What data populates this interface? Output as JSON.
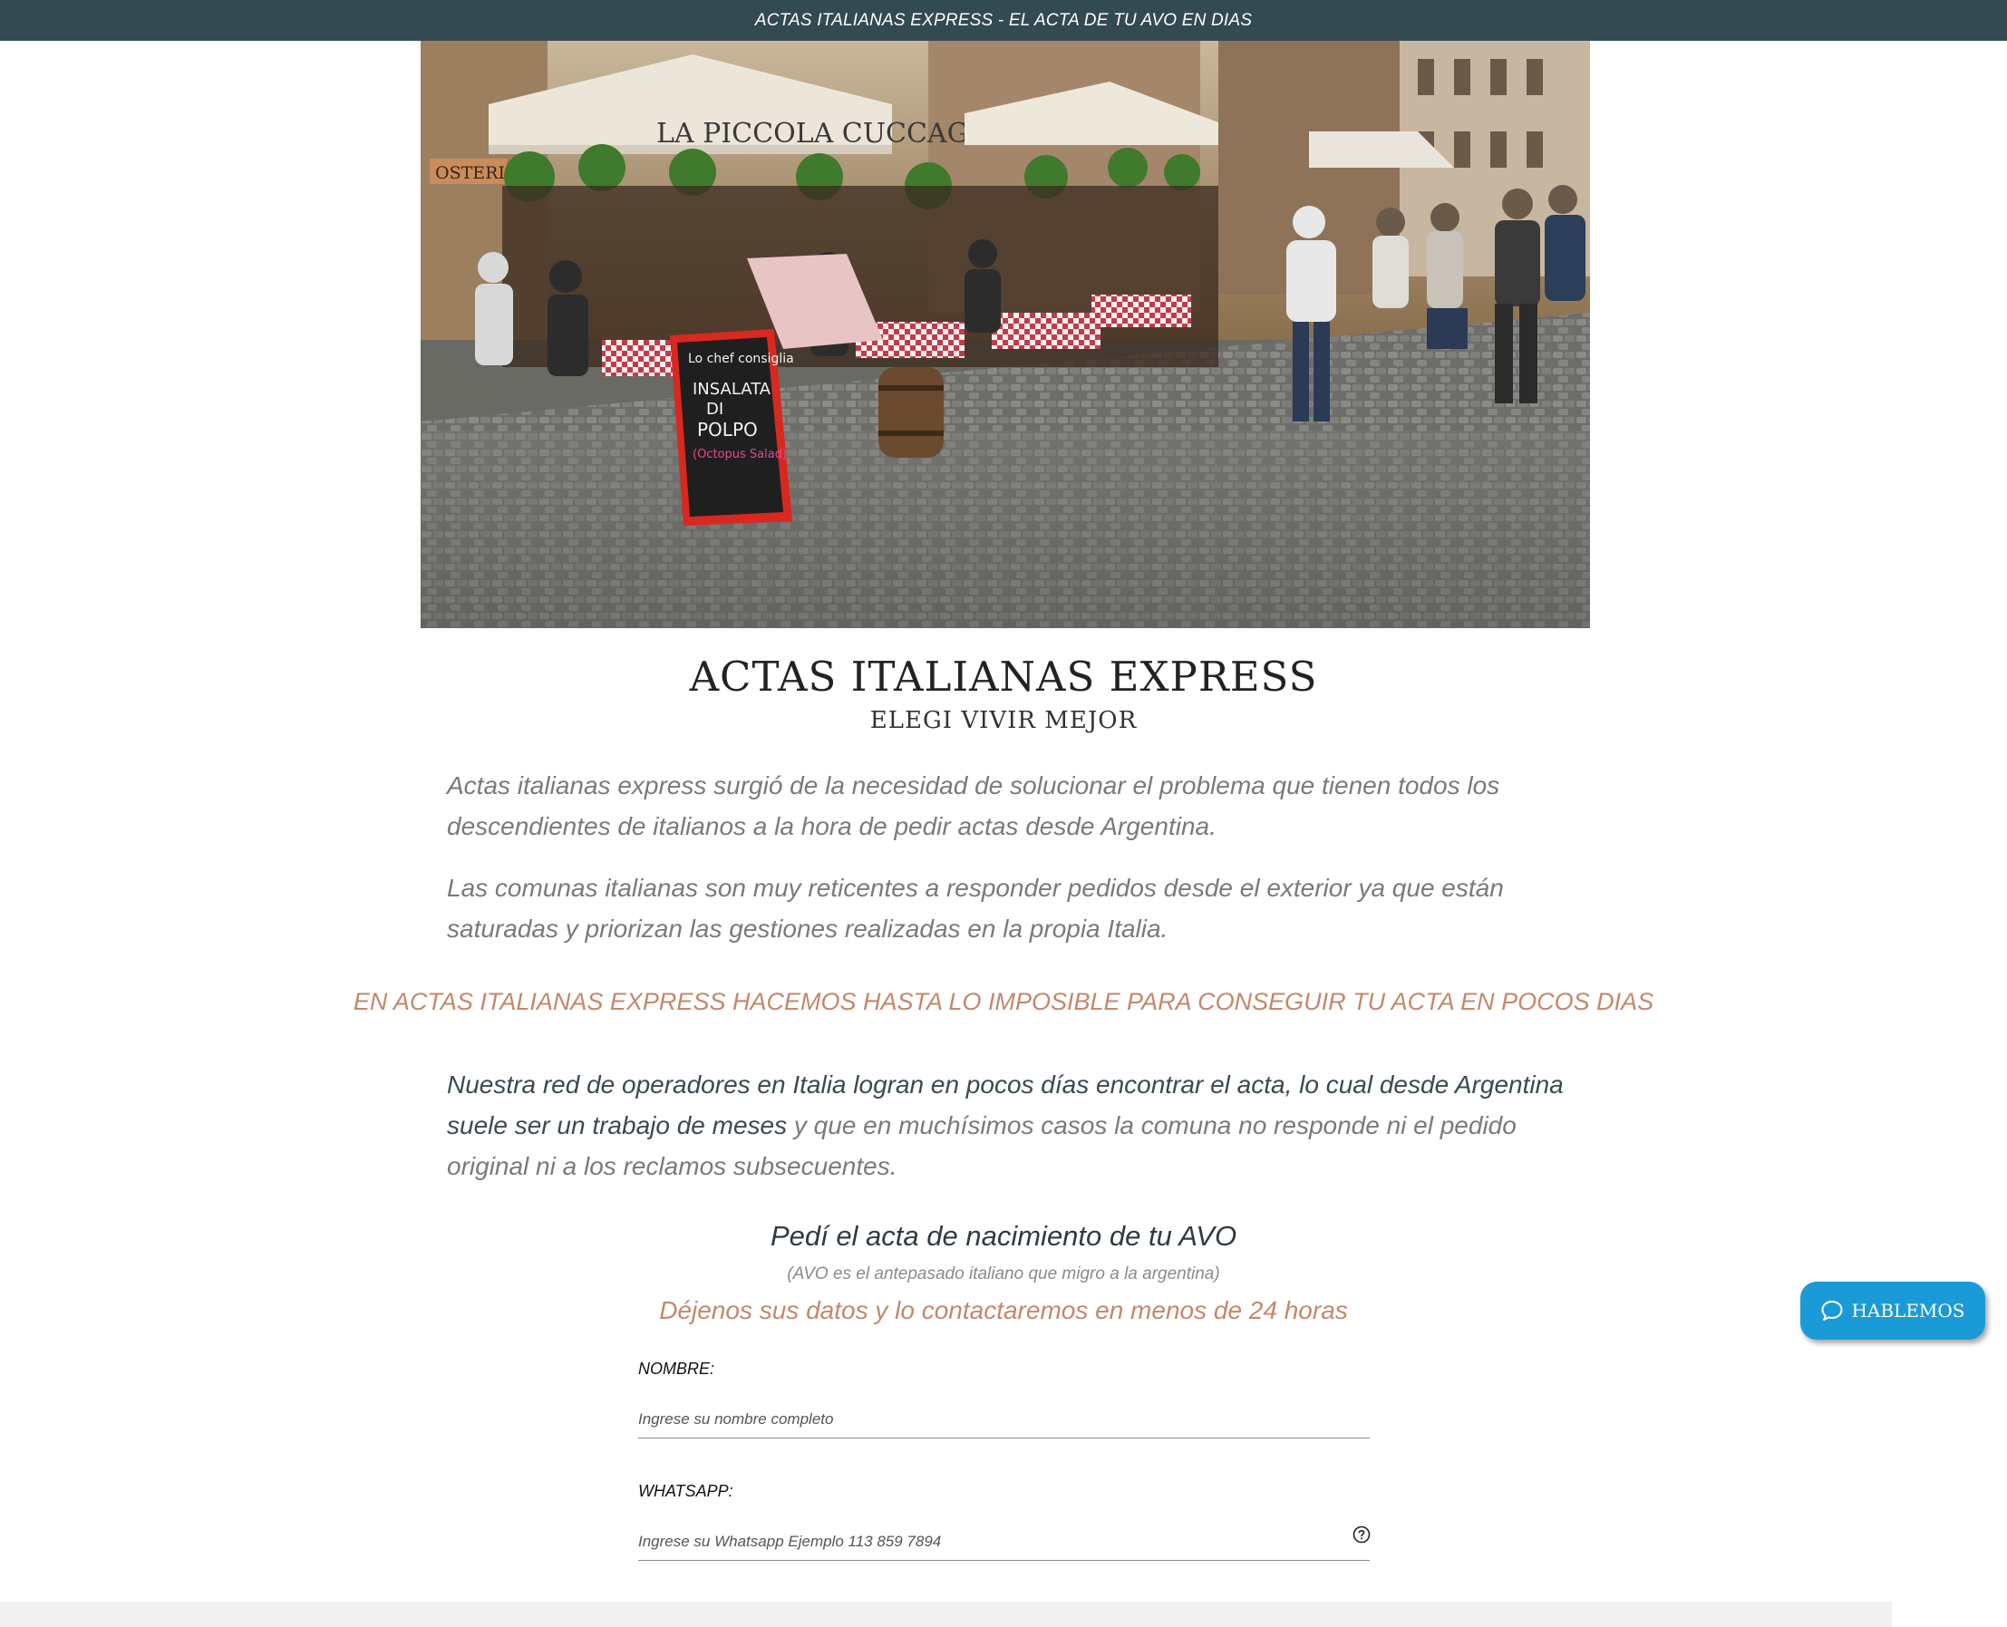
{
  "topbar": {
    "text": "ACTAS ITALIANAS EXPRESS - EL ACTA DE TU AVO EN DIAS"
  },
  "hero": {
    "awning_sign": "LA PICCOLA CUCCAGNA",
    "side_sign": "OSTERIA",
    "chalkboard_lines": [
      "Lo chef consiglia",
      "INSALATA",
      "DI",
      "POLPO",
      "(Octopus Salad)"
    ]
  },
  "header": {
    "title": "ACTAS ITALIANAS EXPRESS",
    "subtitle": "ELEGI VIVIR MEJOR"
  },
  "content": {
    "p1": "Actas italianas express surgió de la necesidad de solucionar el problema que tienen todos los descendientes de italianos a la hora de pedir actas desde Argentina.",
    "p2": "Las comunas italianas son muy reticentes a responder pedidos desde el exterior ya que están saturadas y priorizan las gestiones realizadas en la propia Italia.",
    "highlight": "EN ACTAS ITALIANAS EXPRESS HACEMOS HASTA LO IMPOSIBLE PARA CONSEGUIR TU ACTA EN POCOS DIAS",
    "p4_strong": "Nuestra red de operadores en Italia logran en pocos días encontrar el acta, lo cual desde Argentina suele ser un trabajo de meses",
    "p4_rest": " y que en muchísimos casos la comuna no responde ni el pedido original ni a los reclamos subsecuentes."
  },
  "form": {
    "title": "Pedí el acta de nacimiento de tu AVO",
    "note": "(AVO es el antepasado italiano que migro a la argentina)",
    "cta": "Déjenos sus datos y lo contactaremos en menos de 24 horas",
    "nombre": {
      "label": "NOMBRE:",
      "placeholder": "Ingrese su nombre completo",
      "value": ""
    },
    "whatsapp": {
      "label": "WHATSAPP:",
      "placeholder": "Ingrese su Whatsapp Ejemplo 113 859 7894",
      "value": ""
    }
  },
  "chat": {
    "label": "HABLEMOS"
  },
  "colors": {
    "topbar": "#344a52",
    "accent": "#c5876a",
    "chat": "#1a9bd7"
  },
  "icons": [
    "chat-bubble-icon",
    "help-circle-icon"
  ]
}
